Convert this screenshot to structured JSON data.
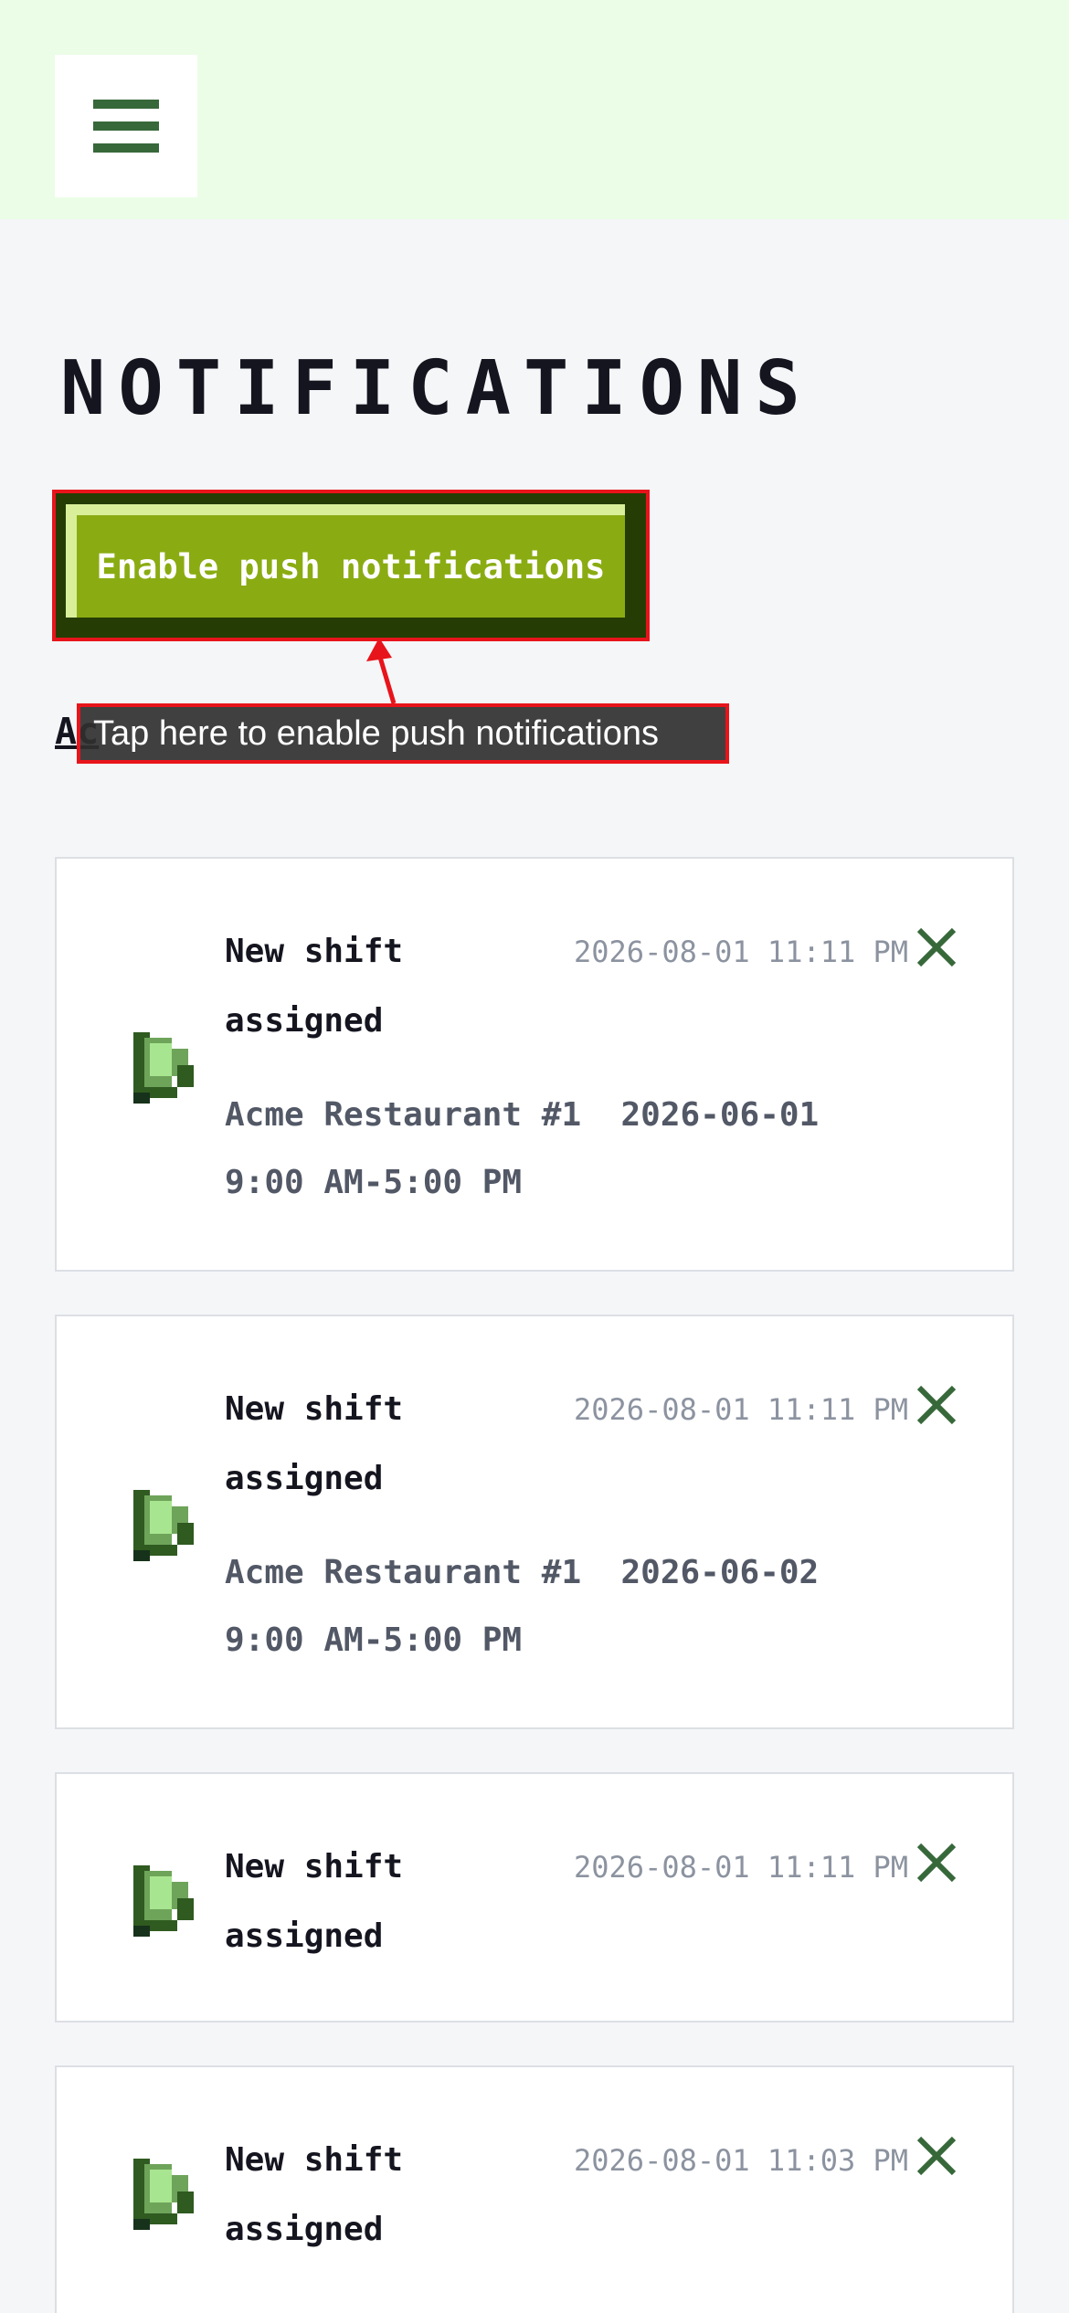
{
  "header": {
    "menu_icon": "hamburger-menu-icon"
  },
  "page": {
    "title": "NOTIFICATIONS",
    "push_button_label": "Enable push notifications",
    "link_label": "Ac",
    "tooltip_text": "Tap here to enable push notifications"
  },
  "colors": {
    "header_bg": "#ebfde6",
    "accent_green": "#37683a",
    "button_green": "#8aac12",
    "highlight_red": "#e8141b"
  },
  "notifications": [
    {
      "title": "New shift assigned",
      "time": "2026-08-01 11:11 PM",
      "body": "Acme Restaurant #1  2026-06-01 9:00 AM-5:00 PM",
      "icon": "bell-icon"
    },
    {
      "title": "New shift assigned",
      "time": "2026-08-01 11:11 PM",
      "body": "Acme Restaurant #1  2026-06-02 9:00 AM-5:00 PM",
      "icon": "bell-icon"
    },
    {
      "title": "New shift assigned",
      "time": "2026-08-01 11:11 PM",
      "body": "",
      "icon": "bell-icon"
    },
    {
      "title": "New shift assigned",
      "time": "2026-08-01 11:03 PM",
      "body": "",
      "icon": "bell-icon"
    }
  ]
}
